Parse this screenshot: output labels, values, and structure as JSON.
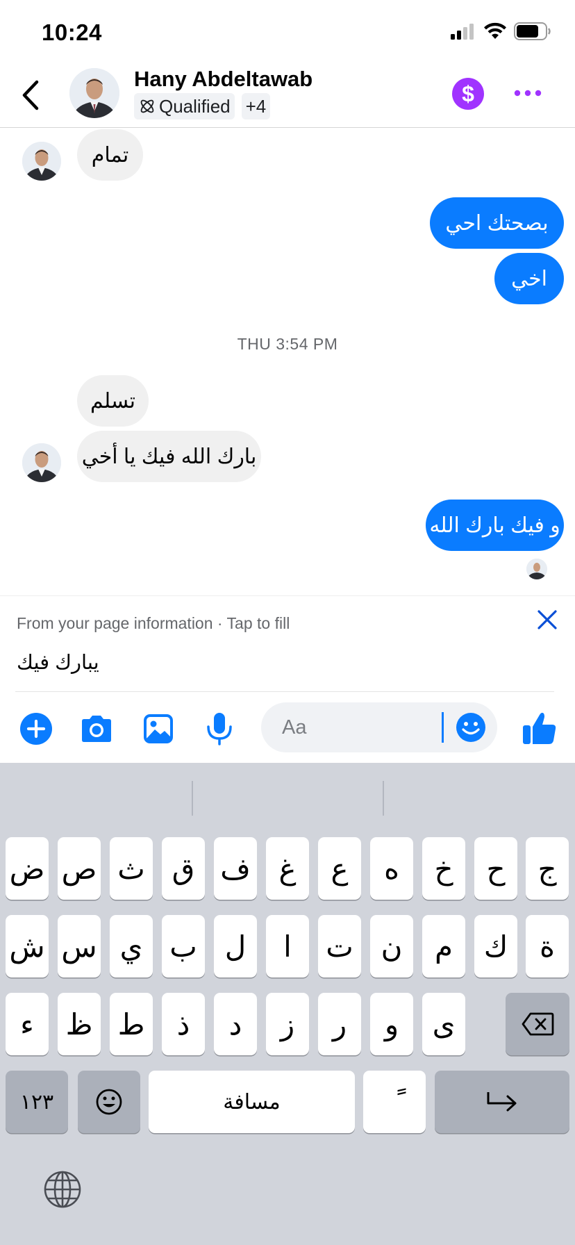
{
  "status": {
    "time": "10:24"
  },
  "header": {
    "name": "Hany Abdeltawab",
    "tag_label": "Qualified",
    "tag_more": "+4",
    "dollar_symbol": "$"
  },
  "messages": {
    "m1": "تمام",
    "m2": "بصحتك احي",
    "m3": "اخي",
    "timestamp": "THU 3:54 PM",
    "m4": "تسلم",
    "m5": "بارك الله فيك يا أخي",
    "m6": "و فيك بارك الله"
  },
  "suggestion": {
    "hint": "From your page information · Tap to fill",
    "text": "يبارك فيك"
  },
  "composer": {
    "placeholder": "Aa"
  },
  "keyboard": {
    "row1": [
      "ض",
      "ص",
      "ث",
      "ق",
      "ف",
      "غ",
      "ع",
      "ه",
      "خ",
      "ح",
      "ج"
    ],
    "row2": [
      "ش",
      "س",
      "ي",
      "ب",
      "ل",
      "ا",
      "ت",
      "ن",
      "م",
      "ك",
      "ة"
    ],
    "row3": [
      "ء",
      "ظ",
      "ط",
      "ذ",
      "د",
      "ز",
      "ر",
      "و",
      "ى"
    ],
    "numbers_label": "١٢٣",
    "space_label": "مسافة",
    "diacritic_label": "ً"
  },
  "colors": {
    "accent": "#0a7cff",
    "incoming_bubble": "#f0f0f0",
    "dollar_button": "#a033ff",
    "keyboard_bg": "#d1d4db"
  },
  "icons": [
    "back-chevron",
    "dollar",
    "more-dots",
    "plus",
    "camera",
    "image",
    "microphone",
    "emoji",
    "thumbs-up",
    "close",
    "backspace",
    "return",
    "globe"
  ]
}
